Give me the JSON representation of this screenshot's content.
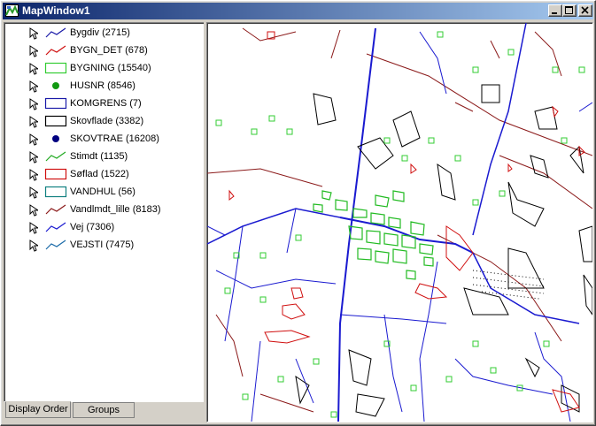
{
  "window": {
    "title": "MapWindow1"
  },
  "title_buttons": {
    "minimize": "minimize-icon",
    "maximize": "maximize-icon",
    "close": "close-icon"
  },
  "layers": [
    {
      "label": "Bygdiv (2715)",
      "symbol": "line",
      "color": "#1a1aa8"
    },
    {
      "label": "BYGN_DET (678)",
      "symbol": "line",
      "color": "#d01010"
    },
    {
      "label": "BYGNING (15540)",
      "symbol": "poly",
      "color": "#33cc33"
    },
    {
      "label": "HUSNR (8546)",
      "symbol": "dot",
      "color": "#119911"
    },
    {
      "label": "KOMGRENS (7)",
      "symbol": "poly",
      "color": "#1a1aa8"
    },
    {
      "label": "Skovflade (3382)",
      "symbol": "poly",
      "color": "#000000"
    },
    {
      "label": "SKOVTRAE (16208)",
      "symbol": "dot",
      "color": "#000080"
    },
    {
      "label": "Stimdt (1135)",
      "symbol": "line",
      "color": "#22aa22"
    },
    {
      "label": "Søflad (1522)",
      "symbol": "poly",
      "color": "#d01010"
    },
    {
      "label": "VANDHUL (56)",
      "symbol": "poly",
      "color": "#108080"
    },
    {
      "label": "Vandlmdt_lille (8183)",
      "symbol": "line",
      "color": "#8b1a1a"
    },
    {
      "label": "Vej (7306)",
      "symbol": "line",
      "color": "#1a1ad0"
    },
    {
      "label": "VEJSTI (7475)",
      "symbol": "line",
      "color": "#1a6aa8"
    }
  ],
  "tabs": [
    {
      "label": "Display Order",
      "active": true
    },
    {
      "label": "Groups",
      "active": false
    }
  ]
}
